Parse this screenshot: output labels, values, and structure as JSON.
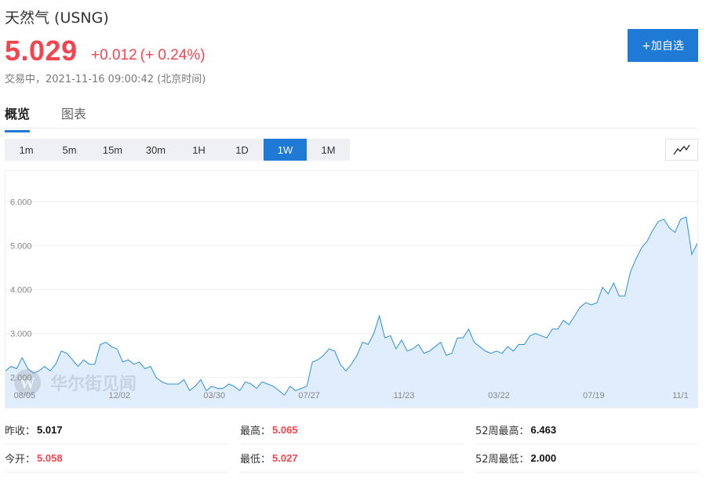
{
  "header": {
    "title": "天然气 (USNG)",
    "price": "5.029",
    "change": "+0.012",
    "change_pct": "(+ 0.24%)",
    "status": "交易中，2021-11-16 09:00:42 (北京时间)"
  },
  "actions": {
    "add_watchlist": "+加自选"
  },
  "tabs": [
    {
      "label": "概览",
      "active": true
    },
    {
      "label": "图表",
      "active": false
    }
  ],
  "periods": [
    {
      "label": "1m",
      "active": false
    },
    {
      "label": "5m",
      "active": false
    },
    {
      "label": "15m",
      "active": false
    },
    {
      "label": "30m",
      "active": false
    },
    {
      "label": "1H",
      "active": false
    },
    {
      "label": "1D",
      "active": false
    },
    {
      "label": "1W",
      "active": true
    },
    {
      "label": "1M",
      "active": false
    }
  ],
  "chart_type_icon": "line-chart-icon",
  "watermark": {
    "text": "华尔街见闻",
    "logo_letter": "W"
  },
  "chart_data": {
    "type": "area",
    "y_ticks": [
      "2.000",
      "3.000",
      "4.000",
      "5.000",
      "6.000"
    ],
    "ylim": [
      1.6,
      6.7
    ],
    "x_ticks": [
      {
        "label": "08/05",
        "i": 3
      },
      {
        "label": "12/02",
        "i": 20
      },
      {
        "label": "03/30",
        "i": 37
      },
      {
        "label": "07/27",
        "i": 54
      },
      {
        "label": "11/23",
        "i": 71
      },
      {
        "label": "03/22",
        "i": 88
      },
      {
        "label": "07/19",
        "i": 105
      },
      {
        "label": "11/1",
        "i": 122
      }
    ],
    "values": [
      2.15,
      2.25,
      2.2,
      2.45,
      2.2,
      2.1,
      2.15,
      2.25,
      2.15,
      2.3,
      2.6,
      2.55,
      2.4,
      2.25,
      2.4,
      2.3,
      2.3,
      2.75,
      2.8,
      2.7,
      2.65,
      2.35,
      2.4,
      2.3,
      2.35,
      2.2,
      2.25,
      2.0,
      1.9,
      1.85,
      1.85,
      1.85,
      1.95,
      1.7,
      1.8,
      1.95,
      1.7,
      1.8,
      1.75,
      1.75,
      1.85,
      1.8,
      1.7,
      1.9,
      1.85,
      1.75,
      1.9,
      1.85,
      1.8,
      1.7,
      1.6,
      1.8,
      1.7,
      1.75,
      1.8,
      2.35,
      2.4,
      2.5,
      2.65,
      2.6,
      2.3,
      2.15,
      2.3,
      2.5,
      2.8,
      2.75,
      3.0,
      3.4,
      2.9,
      2.95,
      2.65,
      2.85,
      2.6,
      2.65,
      2.75,
      2.55,
      2.6,
      2.7,
      2.8,
      2.5,
      2.55,
      2.9,
      2.9,
      3.1,
      2.8,
      2.7,
      2.6,
      2.55,
      2.6,
      2.55,
      2.7,
      2.6,
      2.75,
      2.75,
      2.95,
      3.0,
      2.95,
      2.9,
      3.1,
      3.1,
      3.3,
      3.2,
      3.4,
      3.6,
      3.7,
      3.65,
      3.7,
      4.05,
      3.9,
      4.15,
      3.85,
      3.85,
      4.4,
      4.7,
      4.95,
      5.1,
      5.35,
      5.55,
      5.6,
      5.4,
      5.3,
      5.6,
      5.65,
      4.8,
      5.05
    ]
  },
  "stats": {
    "prev_close": {
      "label": "昨收：",
      "value": "5.017"
    },
    "open": {
      "label": "今开：",
      "value": "5.058"
    },
    "high": {
      "label": "最高：",
      "value": "5.065"
    },
    "low": {
      "label": "最低：",
      "value": "5.027"
    },
    "high_52w": {
      "label": "52周最高：",
      "value": "6.463"
    },
    "low_52w": {
      "label": "52周最低：",
      "value": "2.000"
    }
  }
}
